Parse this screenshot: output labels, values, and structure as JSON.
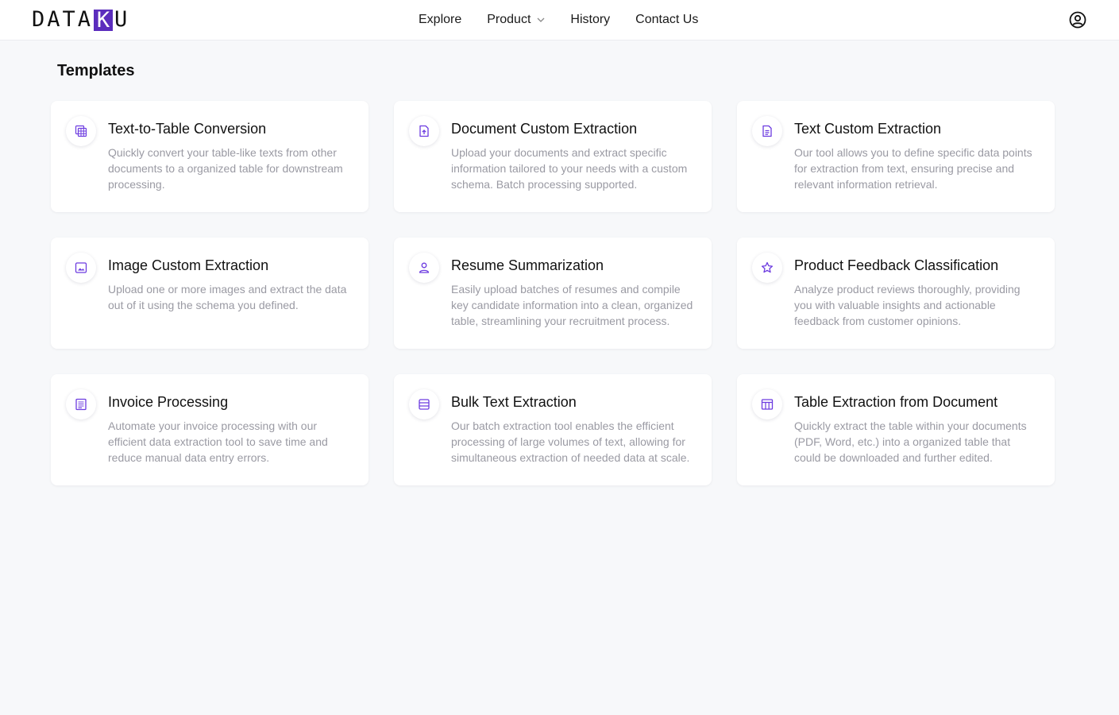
{
  "header": {
    "logo": {
      "pre": "DATA",
      "k": "K",
      "post": "U"
    },
    "nav": [
      {
        "label": "Explore"
      },
      {
        "label": "Product"
      },
      {
        "label": "History"
      },
      {
        "label": "Contact Us"
      }
    ],
    "user_icon": "user-circle-icon"
  },
  "main": {
    "title": "Templates",
    "accent_color": "#6d3ce0",
    "cards": [
      {
        "icon": "table-calc-icon",
        "title": "Text-to-Table Conversion",
        "description": "Quickly convert your table-like texts from other documents to a organized table for downstream processing."
      },
      {
        "icon": "file-upload-icon",
        "title": "Document Custom Extraction",
        "description": "Upload your documents and extract specific information tailored to your needs with a custom schema. Batch processing supported."
      },
      {
        "icon": "document-text-icon",
        "title": "Text Custom Extraction",
        "description": "Our tool allows you to define specific data points for extraction from text, ensuring precise and relevant information retrieval."
      },
      {
        "icon": "image-icon",
        "title": "Image Custom Extraction",
        "description": "Upload one or more images and extract the data out of it using the schema you defined."
      },
      {
        "icon": "person-icon",
        "title": "Resume Summarization",
        "description": "Easily upload batches of resumes and compile key candidate information into a clean, organized table, streamlining your recruitment process."
      },
      {
        "icon": "star-icon",
        "title": "Product Feedback Classification",
        "description": "Analyze product reviews thoroughly, providing you with valuable insights and actionable feedback from customer opinions."
      },
      {
        "icon": "invoice-icon",
        "title": "Invoice Processing",
        "description": "Automate your invoice processing with our efficient data extraction tool to save time and reduce manual data entry errors."
      },
      {
        "icon": "list-box-icon",
        "title": "Bulk Text Extraction",
        "description": "Our batch extraction tool enables the efficient processing of large volumes of text, allowing for simultaneous extraction of needed data at scale."
      },
      {
        "icon": "table-layout-icon",
        "title": "Table Extraction from Document",
        "description": "Quickly extract the table within your documents (PDF, Word, etc.) into a organized table that could be downloaded and further edited."
      }
    ]
  }
}
